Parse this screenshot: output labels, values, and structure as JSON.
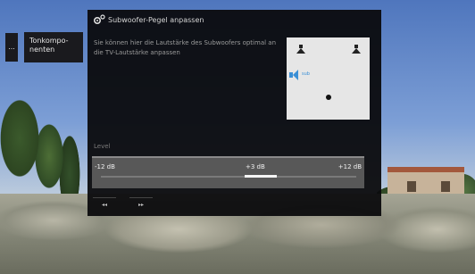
{
  "side_menu": {
    "small_tile_label": "...",
    "tile_label": "Tonkompo-\nnenten"
  },
  "dialog": {
    "title": "Subwoofer-Pegel anpassen",
    "description": "Sie können hier die Lautstärke des Subwoofers optimal an die TV-Lautstärke anpassen",
    "diagram": {
      "sub_label": "sub"
    },
    "level": {
      "label": "Level",
      "min_label": "-12 dB",
      "current_label": "+3 dB",
      "max_label": "+12 dB",
      "min": -12,
      "max": 12,
      "value": 3
    },
    "controls": {
      "prev_icon": "rewind-icon",
      "prev_glyph": "◂◂",
      "next_icon": "fast-forward-icon",
      "next_glyph": "▸▸"
    }
  },
  "colors": {
    "dialog_bg": "#0a0a0c",
    "accent_blue": "#3a8fd6",
    "slider_fill": "#f5f5f5"
  }
}
